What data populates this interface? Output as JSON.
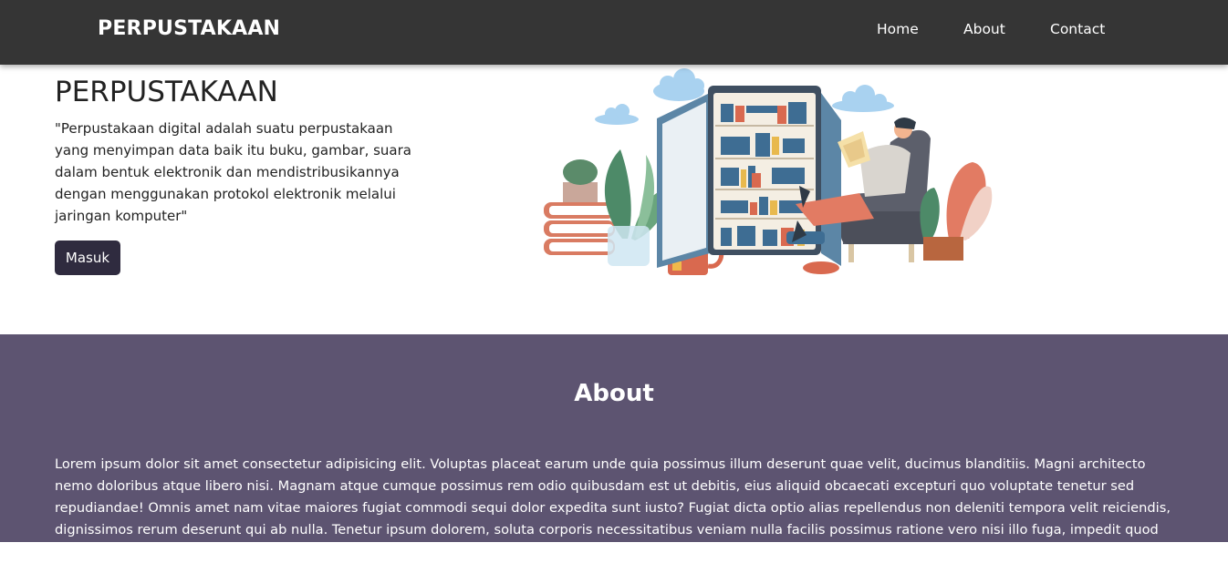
{
  "navbar": {
    "brand": "PERPUSTAKAAN",
    "links": [
      {
        "label": "Home"
      },
      {
        "label": "About"
      },
      {
        "label": "Contact"
      }
    ]
  },
  "hero": {
    "title": "PERPUSTAKAAN",
    "quote": "\"Perpustakaan digital adalah suatu perpustakaan yang menyimpan data baik itu buku, gambar, suara dalam bentuk elektronik dan mendistribusikannya dengan menggunakan protokol elektronik melalui jaringan komputer\"",
    "button_label": "Masuk"
  },
  "about": {
    "title": "About",
    "text": "Lorem ipsum dolor sit amet consectetur adipisicing elit. Voluptas placeat earum unde quia possimus illum deserunt quae velit, ducimus blanditiis. Magni architecto nemo doloribus atque libero nisi. Magnam atque cumque possimus rem odio quibusdam est ut debitis, eius aliquid obcaecati excepturi quo voluptate tenetur sed repudiandae! Omnis amet nam vitae maiores fugiat commodi sequi dolor expedita sunt iusto? Fugiat dicta optio alias repellendus non deleniti tempora velit reiciendis, dignissimos rerum deserunt qui ab nulla. Tenetur ipsum dolorem, soluta corporis necessitatibus veniam nulla facilis possimus ratione vero nisi illo fuga, impedit quod eos eaque dolorum."
  },
  "colors": {
    "navbar_bg": "#353535",
    "button_bg": "#2f2b3f",
    "about_bg": "#5d5471"
  }
}
